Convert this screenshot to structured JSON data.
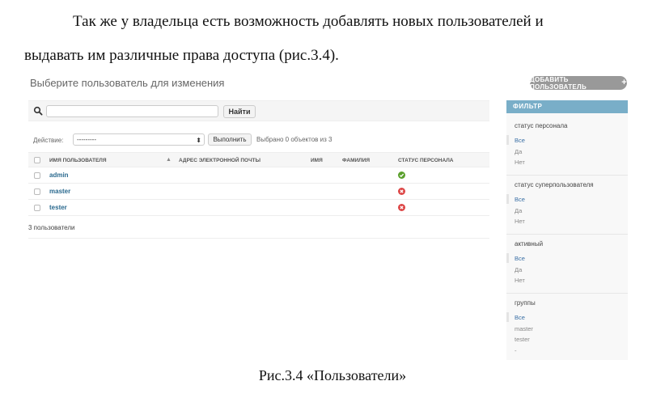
{
  "document": {
    "para_line1": "Так же у владельца есть возможность добавлять новых пользователей и",
    "para_line2": "выдавать им различные права доступа (рис.3.4).",
    "caption": "Рис.3.4 «Пользователи»"
  },
  "admin": {
    "title": "Выберите пользователь для изменения",
    "add_button": "ДОБАВИТЬ ПОЛЬЗОВАТЕЛЬ",
    "search": {
      "value": "",
      "button": "Найти"
    },
    "action": {
      "label": "Действие:",
      "selected": "---------",
      "go_button": "Выполнить",
      "selected_text": "Выбрано 0 объектов из 3"
    },
    "columns": [
      "ИМЯ ПОЛЬЗОВАТЕЛЯ",
      "АДРЕС ЭЛЕКТРОННОЙ ПОЧТЫ",
      "ИМЯ",
      "ФАМИЛИЯ",
      "СТАТУС ПЕРСОНАЛА"
    ],
    "rows": [
      {
        "username": "admin",
        "email": "",
        "first_name": "",
        "last_name": "",
        "staff": true
      },
      {
        "username": "master",
        "email": "",
        "first_name": "",
        "last_name": "",
        "staff": false
      },
      {
        "username": "tester",
        "email": "",
        "first_name": "",
        "last_name": "",
        "staff": false
      }
    ],
    "count": "3 пользователи",
    "filter": {
      "title": "ФИЛЬТР",
      "groups": [
        {
          "title": "статус персонала",
          "items": [
            "Все",
            "Да",
            "Нет"
          ]
        },
        {
          "title": "статус суперпользователя",
          "items": [
            "Все",
            "Да",
            "Нет"
          ]
        },
        {
          "title": "активный",
          "items": [
            "Все",
            "Да",
            "Нет"
          ]
        },
        {
          "title": "группы",
          "items": [
            "Все",
            "master",
            "tester",
            "-"
          ]
        }
      ]
    },
    "colors": {
      "link": "#2b6a8f",
      "filter_header": "#79aec8",
      "yes": "#5aa02c",
      "no": "#dd4646"
    }
  }
}
